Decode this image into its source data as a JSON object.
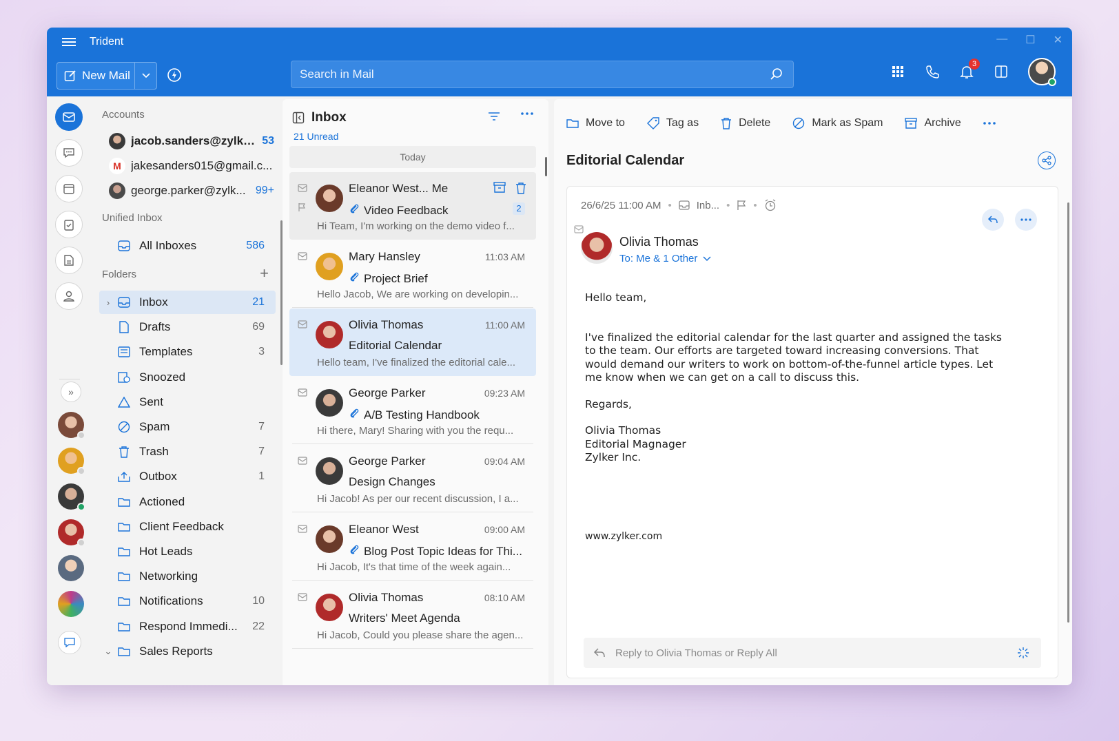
{
  "app": {
    "title": "Trident"
  },
  "header": {
    "new_mail": "New Mail",
    "search_placeholder": "Search in Mail",
    "notification_count": "3"
  },
  "sidebar": {
    "accounts_title": "Accounts",
    "accounts": [
      {
        "name": "jacob.sanders@zylke...",
        "count": "53",
        "bold": true
      },
      {
        "name": "jakesanders015@gmail.c...",
        "count": ""
      },
      {
        "name": "george.parker@zylk...",
        "count": "99+"
      }
    ],
    "unified_title": "Unified Inbox",
    "all_inboxes": {
      "label": "All Inboxes",
      "count": "586"
    },
    "folders_title": "Folders",
    "folders": [
      {
        "label": "Inbox",
        "count": "21",
        "icon": "inbox-icon"
      },
      {
        "label": "Drafts",
        "count": "69",
        "icon": "draft-icon"
      },
      {
        "label": "Templates",
        "count": "3",
        "icon": "template-icon"
      },
      {
        "label": "Snoozed",
        "count": "",
        "icon": "snooze-icon"
      },
      {
        "label": "Sent",
        "count": "",
        "icon": "sent-icon"
      },
      {
        "label": "Spam",
        "count": "7",
        "icon": "spam-icon"
      },
      {
        "label": "Trash",
        "count": "7",
        "icon": "trash-icon"
      },
      {
        "label": "Outbox",
        "count": "1",
        "icon": "outbox-icon"
      },
      {
        "label": "Actioned",
        "count": "",
        "icon": "folder-icon"
      },
      {
        "label": "Client Feedback",
        "count": "",
        "icon": "folder-icon"
      },
      {
        "label": "Hot Leads",
        "count": "",
        "icon": "folder-icon"
      },
      {
        "label": "Networking",
        "count": "",
        "icon": "folder-icon"
      },
      {
        "label": "Notifications",
        "count": "10",
        "icon": "folder-icon"
      },
      {
        "label": "Respond Immedi...",
        "count": "22",
        "icon": "folder-icon"
      },
      {
        "label": "Sales Reports",
        "count": "",
        "icon": "folder-icon"
      }
    ]
  },
  "list": {
    "title": "Inbox",
    "unread": "21 Unread",
    "group": "Today",
    "mails": [
      {
        "from": "Eleanor West... Me",
        "time": "",
        "subject": "Video Feedback",
        "preview": "Hi Team, I'm working on the demo video f...",
        "attach": true,
        "count": "2"
      },
      {
        "from": "Mary Hansley",
        "time": "11:03 AM",
        "subject": "Project Brief",
        "preview": "Hello Jacob, We are working on developin...",
        "attach": true
      },
      {
        "from": "Olivia Thomas",
        "time": "11:00 AM",
        "subject": "Editorial Calendar",
        "preview": "Hello team, I've finalized the editorial cale...",
        "attach": false
      },
      {
        "from": "George Parker",
        "time": "09:23 AM",
        "subject": "A/B Testing Handbook",
        "preview": "Hi there, Mary! Sharing with you the requ...",
        "attach": true
      },
      {
        "from": "George Parker",
        "time": "09:04 AM",
        "subject": "Design Changes",
        "preview": "Hi Jacob! As per our recent discussion, I a...",
        "attach": false
      },
      {
        "from": "Eleanor West",
        "time": "09:00 AM",
        "subject": "Blog Post Topic Ideas for Thi...",
        "preview": "Hi Jacob, It's that time of the week again...",
        "attach": true
      },
      {
        "from": "Olivia Thomas",
        "time": "08:10 AM",
        "subject": "Writers' Meet Agenda",
        "preview": "Hi Jacob, Could you please share the agen...",
        "attach": false
      }
    ]
  },
  "reader": {
    "toolbar": {
      "move": "Move to",
      "tag": "Tag as",
      "delete": "Delete",
      "spam": "Mark as Spam",
      "archive": "Archive"
    },
    "subject": "Editorial Calendar",
    "date": "26/6/25 11:00 AM",
    "folder": "Inb...",
    "sender": "Olivia Thomas",
    "to": "To: Me & 1 Other",
    "greeting": "Hello team,",
    "paragraph": "I've finalized the editorial calendar for the last quarter and assigned the tasks to the team. Our efforts are targeted toward increasing conversions. That would demand our writers to work on bottom-of-the-funnel article types. Let me know when we can get on a call to discuss this.",
    "regards": "Regards,",
    "sig_name": "Olivia Thomas",
    "sig_title": "Editorial Magnager",
    "sig_company": "Zylker Inc.",
    "website": "www.zylker.com",
    "reply_prefix": "Reply to Olivia Thomas",
    "reply_or": "or",
    "reply_all": "Reply All"
  },
  "colors": {
    "accent": "#1a73d9",
    "selected": "#dce9f9"
  }
}
